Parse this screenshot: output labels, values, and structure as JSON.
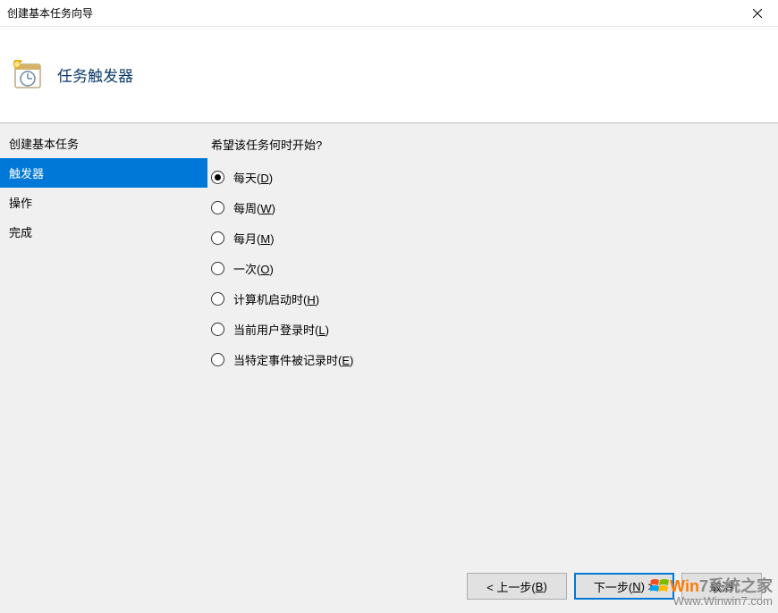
{
  "window": {
    "title": "创建基本任务向导"
  },
  "header": {
    "title": "任务触发器"
  },
  "sidebar": {
    "items": [
      {
        "label": "创建基本任务",
        "active": false
      },
      {
        "label": "触发器",
        "active": true
      },
      {
        "label": "操作",
        "active": false
      },
      {
        "label": "完成",
        "active": false
      }
    ]
  },
  "content": {
    "question": "希望该任务何时开始?",
    "options": [
      {
        "label": "每天",
        "accel": "D",
        "checked": true
      },
      {
        "label": "每周",
        "accel": "W",
        "checked": false
      },
      {
        "label": "每月",
        "accel": "M",
        "checked": false
      },
      {
        "label": "一次",
        "accel": "O",
        "checked": false
      },
      {
        "label": "计算机启动时",
        "accel": "H",
        "checked": false
      },
      {
        "label": "当前用户登录时",
        "accel": "L",
        "checked": false
      },
      {
        "label": "当特定事件被记录时",
        "accel": "E",
        "checked": false
      }
    ]
  },
  "footer": {
    "back_prefix": "< 上一步(",
    "back_accel": "B",
    "back_suffix": ")",
    "next_prefix": "下一步(",
    "next_accel": "N",
    "next_suffix": ") >",
    "cancel": "取消"
  },
  "watermark": {
    "line1_part1": "Win",
    "line1_part2": "7系统之家",
    "line2": "Www.Winwin7.com"
  }
}
